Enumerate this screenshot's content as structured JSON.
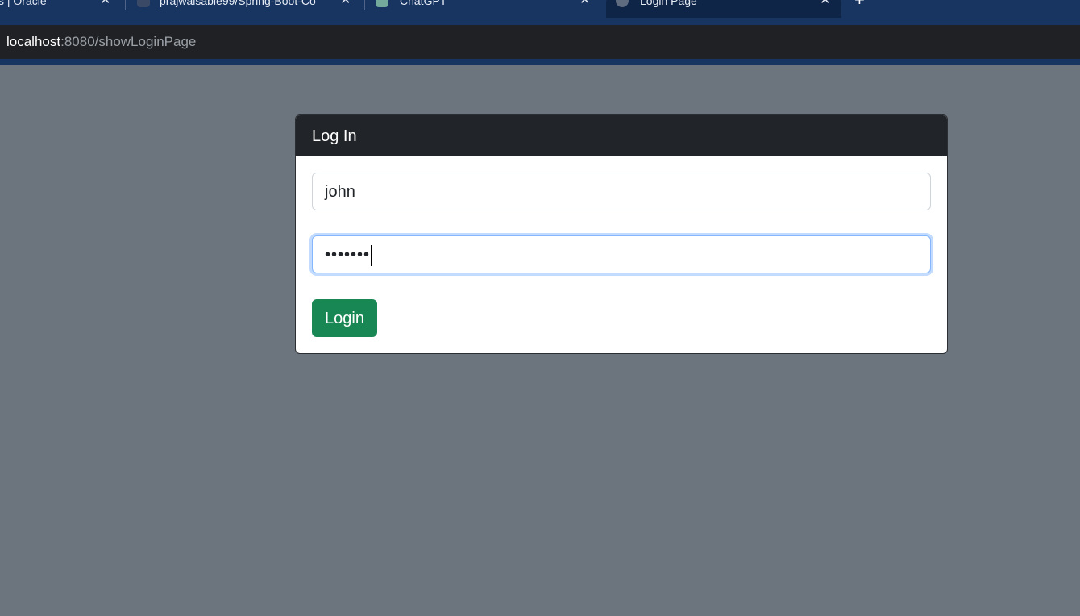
{
  "browser": {
    "tabs": [
      {
        "label": "s | Oracle",
        "close": "✕",
        "active": false
      },
      {
        "label": "prajwalsable99/Spring-Boot-Co",
        "close": "✕",
        "active": false
      },
      {
        "label": "ChatGPT",
        "close": "✕",
        "active": false
      },
      {
        "label": "Login Page",
        "close": "✕",
        "active": true
      }
    ],
    "new_tab": "+",
    "address": {
      "host": "localhost",
      "rest": ":8080/showLoginPage"
    }
  },
  "login": {
    "title": "Log In",
    "username_value": "john",
    "password_mask": "•••••••",
    "button_label": "Login"
  },
  "colors": {
    "page_bg": "#6c757d",
    "header_bg": "#212529",
    "button_bg": "#198754",
    "focus_border": "#86b7fe"
  }
}
